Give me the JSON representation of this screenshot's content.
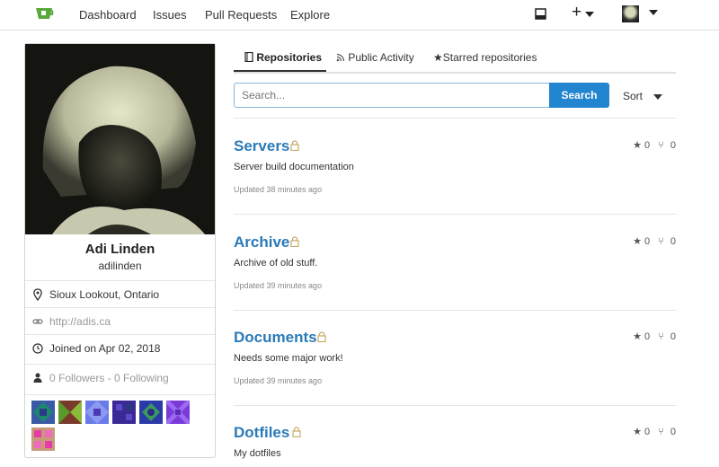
{
  "nav": {
    "items": [
      "Dashboard",
      "Issues",
      "Pull Requests",
      "Explore"
    ],
    "plus": "+"
  },
  "profile": {
    "full_name": "Adi Linden",
    "username": "adilinden",
    "location": "Sioux Lookout, Ontario",
    "website": "http://adis.ca",
    "joined": "Joined on Apr 02, 2018",
    "followers": "0 Followers",
    "separator": " - ",
    "following": "0 Following"
  },
  "tabs": [
    "Repositories",
    "Public Activity",
    "Starred repositories"
  ],
  "search": {
    "placeholder": "Search...",
    "button": "Search"
  },
  "sort": {
    "label": "Sort"
  },
  "repos": [
    {
      "name": "Servers",
      "description": "Server build documentation",
      "updated": "Updated 38 minutes ago",
      "stars": "0",
      "forks": "0",
      "private": true
    },
    {
      "name": "Archive",
      "description": "Archive of old stuff.",
      "updated": "Updated 39 minutes ago",
      "stars": "0",
      "forks": "0",
      "private": true
    },
    {
      "name": "Documents",
      "description": "Needs some major work!",
      "updated": "Updated 39 minutes ago",
      "stars": "0",
      "forks": "0",
      "private": true
    },
    {
      "name": "Dotfiles",
      "description": "My dotfiles",
      "updated": "",
      "stars": "0",
      "forks": "0",
      "private": true
    }
  ],
  "colors": {
    "accent": "#2185d0",
    "link": "#2a7ab8",
    "logo": "#5aa83c",
    "lock": "#c9a96b"
  },
  "icons": [
    "logo-icon",
    "inbox-icon",
    "plus-icon",
    "chevron-down-icon",
    "map-pin-icon",
    "link-icon",
    "clock-icon",
    "user-icon",
    "book-icon",
    "rss-icon",
    "star-icon",
    "fork-icon",
    "lock-icon"
  ]
}
